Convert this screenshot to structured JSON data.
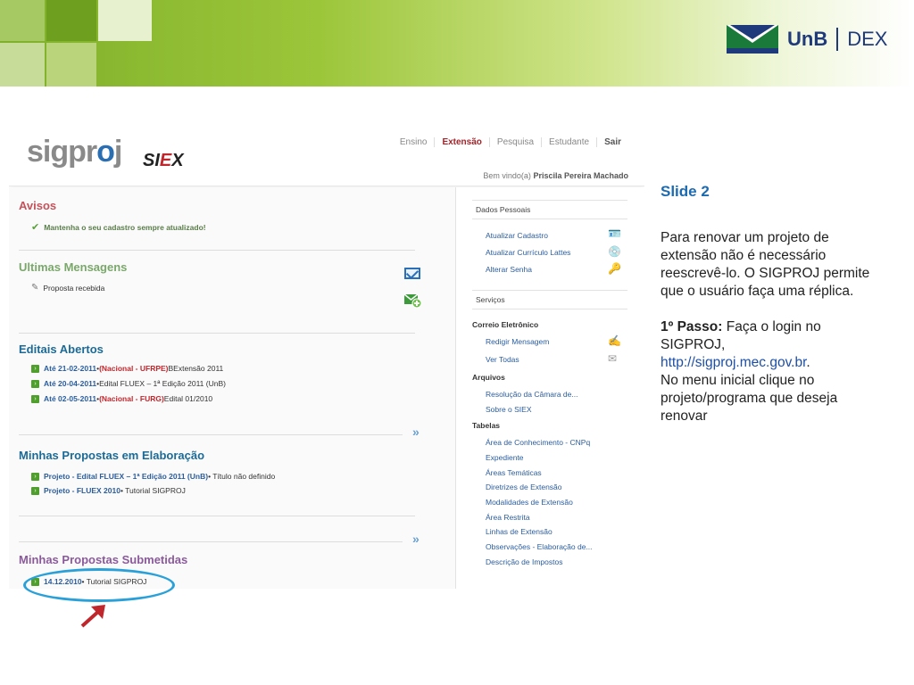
{
  "banner": {
    "logo_unb": "UnB",
    "logo_dex": "DEX"
  },
  "app": {
    "logo_main": "sigpr",
    "logo_o": "o",
    "logo_main_end": "j",
    "logo_siex_s": "SI",
    "logo_siex_e": "E",
    "logo_siex_x": "X",
    "nav": [
      "Ensino",
      "Extensão",
      "Pesquisa",
      "Estudante",
      "Sair"
    ],
    "active_nav": "Extensão",
    "welcome_prefix": "Bem vindo(a) ",
    "welcome_user": "Priscila Pereira Machado"
  },
  "main": {
    "avisos": {
      "title": "Avisos",
      "item": "Mantenha o seu cadastro sempre atualizado!"
    },
    "mensagens": {
      "title": "Ultimas Mensagens",
      "item": "Proposta recebida"
    },
    "editais": {
      "title": "Editais Abertos",
      "items": [
        {
          "date": "Até 21-02-2011",
          "bullet": " • ",
          "tag": "(Nacional - UFRPE)",
          "text": " BExtensão 2011"
        },
        {
          "date": "Até 20-04-2011",
          "bullet": " • ",
          "tag": "",
          "text": "Edital FLUEX – 1ª Edição 2011 (UnB)"
        },
        {
          "date": "Até 02-05-2011",
          "bullet": " • ",
          "tag": "(Nacional - FURG)",
          "text": " Edital 01/2010"
        }
      ]
    },
    "elaboracao": {
      "title": "Minhas Propostas em Elaboração",
      "items": [
        {
          "link": "Projeto - Edital FLUEX – 1ª Edição 2011 (UnB)",
          "text": " • Título não definido"
        },
        {
          "link": "Projeto - FLUEX 2010",
          "text": " • Tutorial SIGPROJ"
        }
      ]
    },
    "submetidas": {
      "title": "Minhas Propostas Submetidas",
      "items": [
        {
          "link": "14.12.2010",
          "text": " • Tutorial SIGPROJ"
        }
      ]
    },
    "more_icon": "double-chevron-right-icon"
  },
  "sidebar": {
    "dados_pessoais": "Dados Pessoais",
    "dados_links": [
      "Atualizar Cadastro",
      "Atualizar Currículo Lattes",
      "Alterar Senha"
    ],
    "servicos": "Serviços",
    "correio": "Correio Eletrônico",
    "correio_links": [
      "Redigir Mensagem",
      "Ver Todas"
    ],
    "arquivos": "Arquivos",
    "arquivos_links": [
      "Resolução da Câmara de...",
      "Sobre o SIEX"
    ],
    "tabelas": "Tabelas",
    "tabelas_links": [
      "Área de Conhecimento - CNPq",
      "Expediente",
      "Áreas Temáticas",
      "Diretrizes de Extensão",
      "Modalidades de Extensão",
      "Área Restrita",
      "Linhas de Extensão",
      "Observações - Elaboração de...",
      "Descrição de Impostos"
    ]
  },
  "slide": {
    "title": "Slide 2",
    "para1": "Para renovar um projeto de extensão não é necessário reescrevê-lo. O SIGPROJ permite que o usuário faça uma réplica.",
    "step_label": "1º Passo:",
    "step_text": " Faça o login no SIGPROJ,",
    "url": "http://sigproj.mec.gov.br",
    "url_after": ".",
    "para2_rest": "No menu inicial clique no projeto/programa que deseja renovar"
  },
  "colors": {
    "accent_blue": "#1c6ab0",
    "highlight_ellipse": "#2aa0d9",
    "arrow_red": "#c0272d",
    "banner_green": "#7fb02a"
  }
}
